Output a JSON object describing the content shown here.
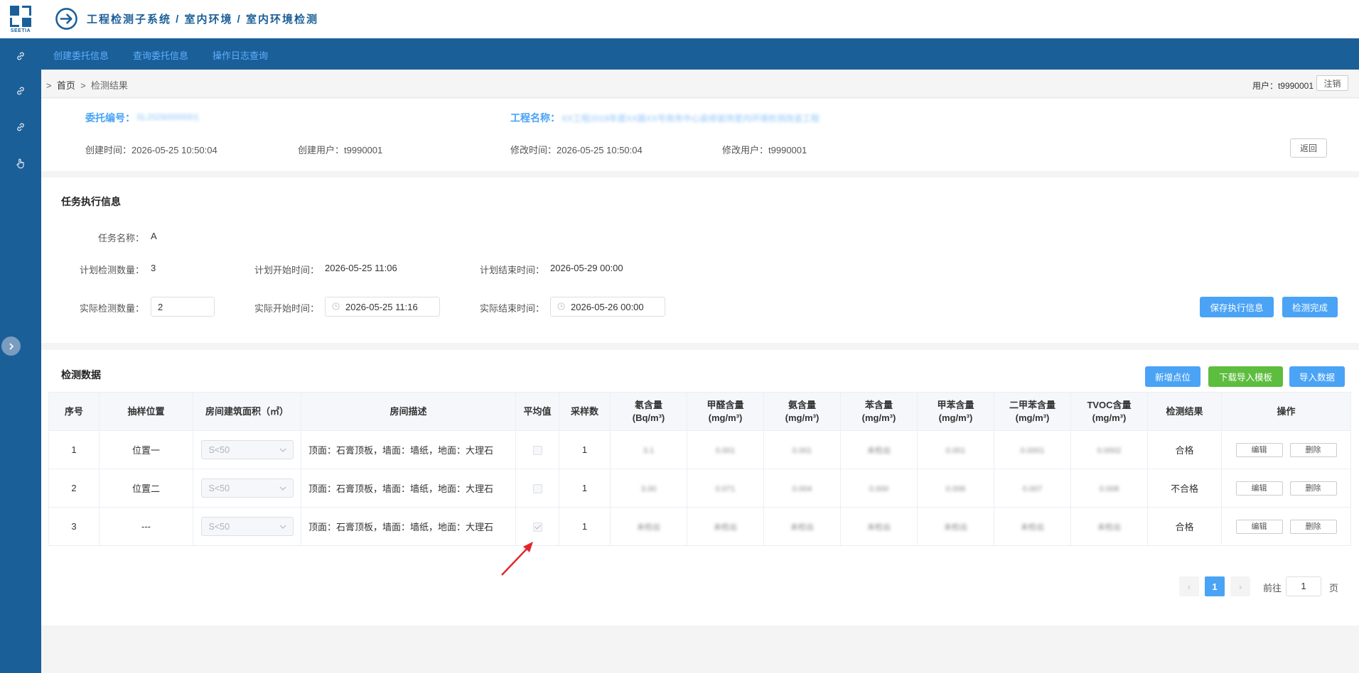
{
  "app": {
    "logo_text": "SEETIA",
    "breadcrumb_title": "工程检测子系统 / 室内环境 / 室内环境检测"
  },
  "sidebar_icons": [
    "link-icon",
    "link-icon",
    "link-icon",
    "hand-pointer-icon"
  ],
  "topnav": {
    "items": [
      "创建委托信息",
      "查询委托信息",
      "操作日志查询"
    ]
  },
  "crumbbar": {
    "sep": ">",
    "home": "首页",
    "current": "检测结果",
    "user": "用户：t9990001",
    "logout_label": "注销"
  },
  "entrust": {
    "entrust_no_label": "委托编号：",
    "entrust_no_value": "SL20260000001",
    "project_label": "工程名称：",
    "project_value": "XX工程2019年度XX路XX号商务中心装修装饰室内环境检测改造工程",
    "created_time_label": "创建时间：",
    "created_time": "2026-05-25 10:50:04",
    "created_user_label": "创建用户：",
    "created_user": "t9990001",
    "modified_time_label": "修改时间：",
    "modified_time": "2026-05-25 10:50:04",
    "modified_user_label": "修改用户：",
    "modified_user": "t9990001",
    "back_label": "返回"
  },
  "task": {
    "title": "任务执行信息",
    "name_label": "任务名称：",
    "name_value": "A",
    "plan_count_label": "计划检测数量：",
    "plan_count": "3",
    "plan_start_label": "计划开始时间：",
    "plan_start": "2026-05-25 11:06",
    "plan_end_label": "计划结束时间：",
    "plan_end": "2026-05-29 00:00",
    "actual_count_label": "实际检测数量：",
    "actual_count": "2",
    "actual_start_label": "实际开始时间：",
    "actual_start": "2026-05-25 11:16",
    "actual_end_label": "实际结束时间：",
    "actual_end": "2026-05-26 00:00",
    "save_label": "保存执行信息",
    "finish_label": "检测完成"
  },
  "detection": {
    "title": "检测数据",
    "add_point_label": "新增点位",
    "download_template_label": "下载导入模板",
    "import_label": "导入数据",
    "columns": [
      "序号",
      "抽样位置",
      "房间建筑面积（㎡）",
      "房间描述",
      "平均值",
      "采样数",
      "氡含量\n(Bq/m³)",
      "甲醛含量\n(mg/m³)",
      "氨含量\n(mg/m³)",
      "苯含量\n(mg/m³)",
      "甲苯含量\n(mg/m³)",
      "二甲苯含量\n(mg/m³)",
      "TVOC含量\n(mg/m³)",
      "检测结果",
      "操作"
    ],
    "rows": [
      {
        "no": "1",
        "position": "位置一",
        "area": "S<50",
        "desc": "顶面：石膏顶板，墙面：墙纸，地面：大理石",
        "avg_checked": false,
        "samples": "1",
        "radon": "3.1",
        "formaldehyde": "0.001",
        "ammonia": "0.001",
        "benzene": "未检出",
        "toluene": "0.001",
        "xylene": "0.0001",
        "tvoc": "0.0002",
        "result": "合格",
        "edit": "编辑",
        "delete": "删除"
      },
      {
        "no": "2",
        "position": "位置二",
        "area": "S<50",
        "desc": "顶面：石膏顶板，墙面：墙纸，地面：大理石",
        "avg_checked": false,
        "samples": "1",
        "radon": "3.00",
        "formaldehyde": "0.071",
        "ammonia": "0.004",
        "benzene": "0.000",
        "toluene": "0.006",
        "xylene": "0.007",
        "tvoc": "0.008",
        "result": "不合格",
        "edit": "编辑",
        "delete": "删除"
      },
      {
        "no": "3",
        "position": "---",
        "area": "S<50",
        "desc": "顶面：石膏顶板，墙面：墙纸，地面：大理石",
        "avg_checked": true,
        "samples": "1",
        "radon": "未检出",
        "formaldehyde": "未检出",
        "ammonia": "未检出",
        "benzene": "未检出",
        "toluene": "未检出",
        "xylene": "未检出",
        "tvoc": "未检出",
        "result": "合格",
        "edit": "编辑",
        "delete": "删除"
      }
    ]
  },
  "pager": {
    "prev": "‹",
    "current": "1",
    "next": "›",
    "goto_label": "前往",
    "goto_value": "1",
    "page_suffix": "页"
  },
  "colors": {
    "brand": "#1b5f98",
    "accent": "#4aa3f5",
    "success": "#5dbd3f",
    "annotation_arrow": "#e3242b"
  }
}
